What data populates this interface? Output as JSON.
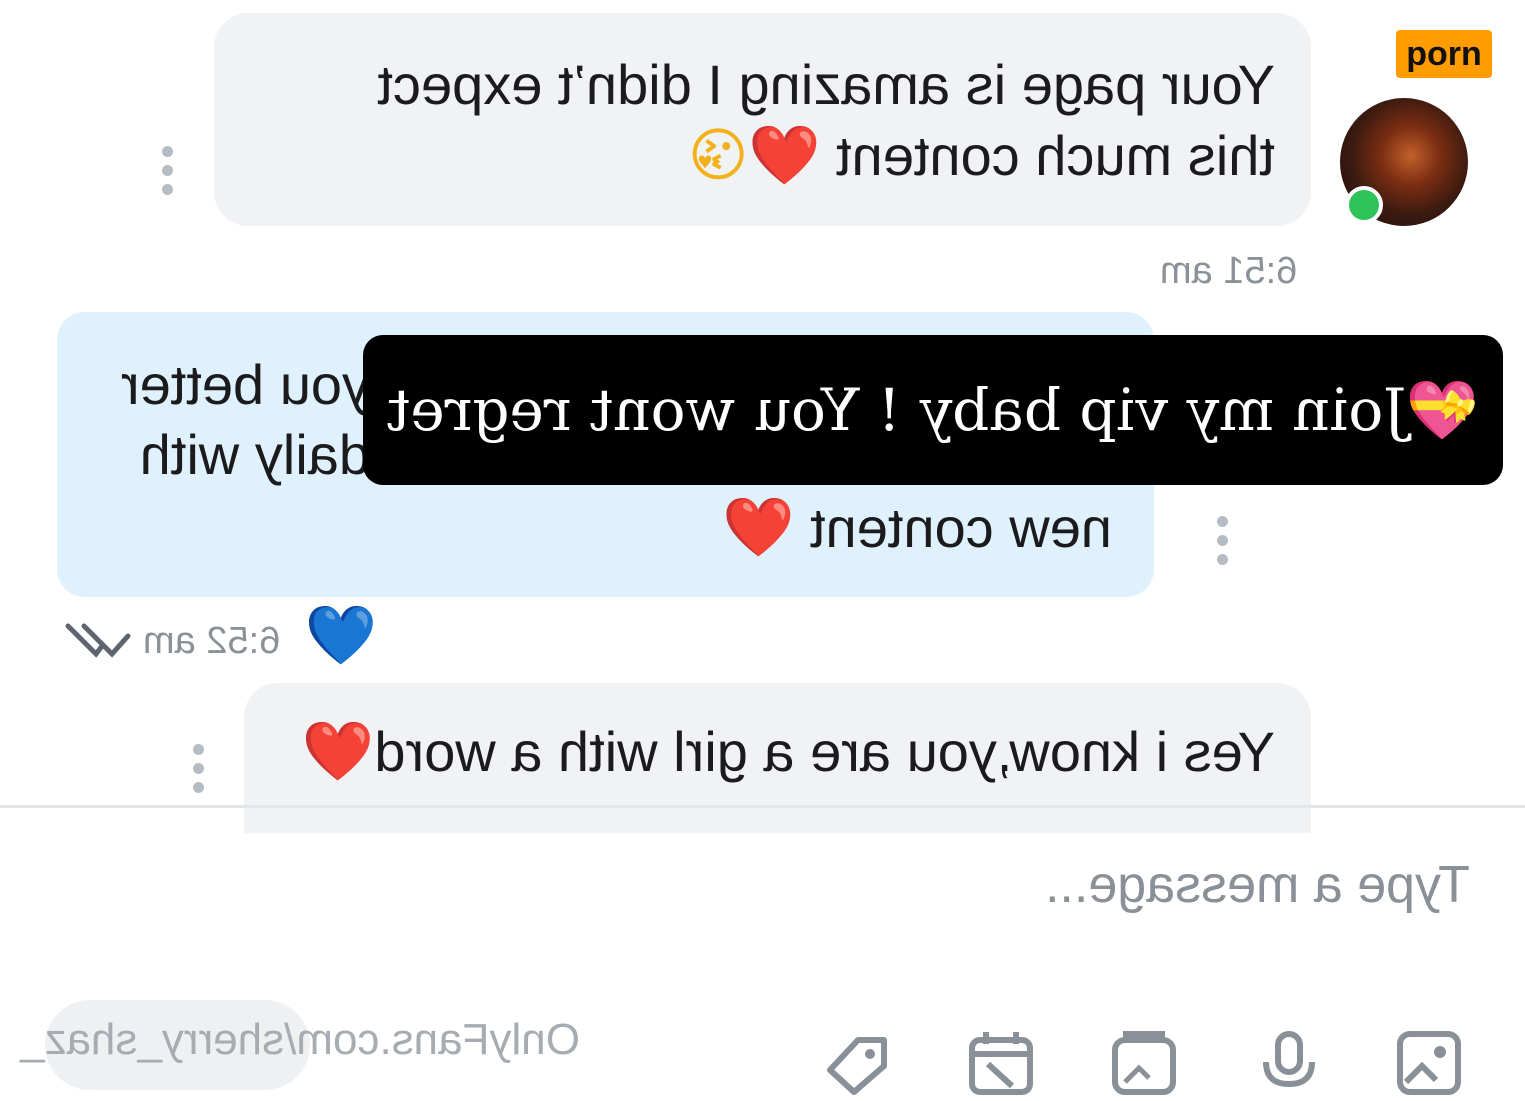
{
  "brand": {
    "badge": "porn"
  },
  "messages": [
    {
      "direction": "incoming",
      "line1": "Your page is amazing I didn’t expect",
      "line2": "this much content",
      "emojis": [
        "❤️",
        "😘"
      ],
      "time": "6:51 am"
    },
    {
      "direction": "outgoing",
      "line1": "you better",
      "line2": "daily with",
      "line3": "new content",
      "emojis": [
        "❤️"
      ],
      "time": "6:52 am",
      "reaction": "💙"
    },
    {
      "direction": "incoming",
      "line1": "Yes i know,you are a girl with a word",
      "emojis": [
        "❤️"
      ]
    }
  ],
  "overlay": {
    "text": "Join my vip baby ! You wont regret",
    "emoji": "💝"
  },
  "composer": {
    "placeholder": "Type a message..."
  },
  "watermark": {
    "text": "OnlyFans.com/sherry_shaz_"
  },
  "toolbar": {
    "icons": [
      "image-icon",
      "microphone-icon",
      "vault-icon",
      "calendar-icon",
      "price-tag-icon"
    ]
  },
  "colors": {
    "incoming_bubble": "#f1f2f4",
    "outgoing_bubble": "#dff1fd",
    "online": "#2ec45a",
    "badge": "#ff9d00",
    "reaction": "#1aa0e8"
  }
}
